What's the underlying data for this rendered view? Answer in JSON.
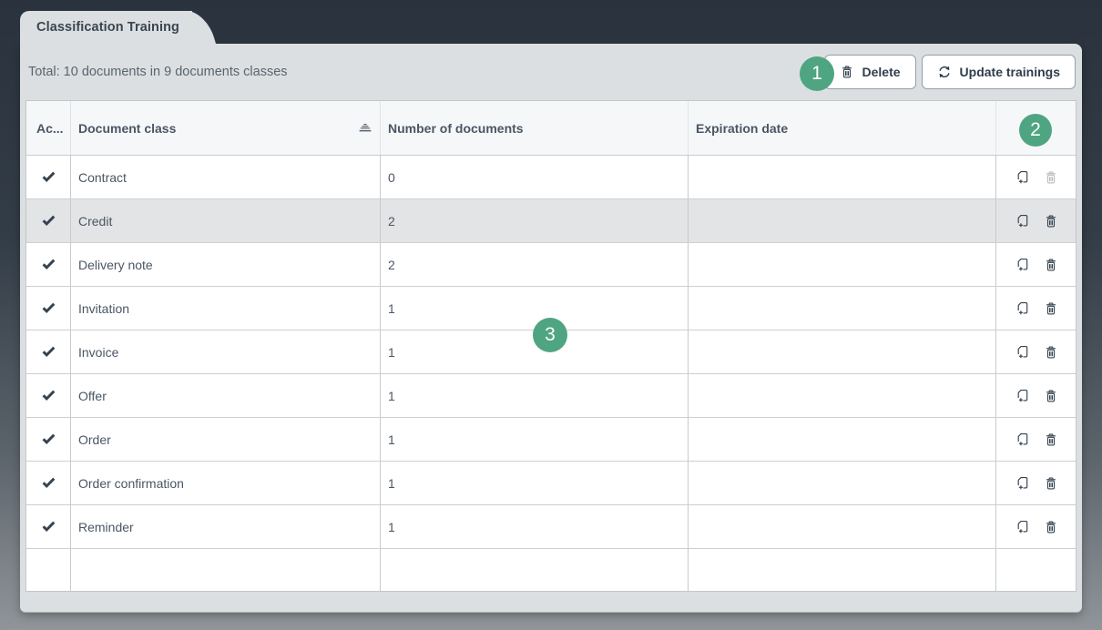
{
  "tab": {
    "label": "Classification Training"
  },
  "toolbar": {
    "summary": "Total: 10 documents in 9 documents classes",
    "buttons": [
      {
        "label": "Delete",
        "icon": "trash-icon"
      },
      {
        "label": "Update trainings",
        "icon": "refresh-icon"
      }
    ]
  },
  "table": {
    "columns": [
      {
        "key": "active",
        "label": "Ac..."
      },
      {
        "key": "document_class",
        "label": "Document class",
        "sorted": "asc"
      },
      {
        "key": "number_of_documents",
        "label": "Number of documents"
      },
      {
        "key": "expiration_date",
        "label": "Expiration date"
      },
      {
        "key": "actions",
        "label": ""
      }
    ],
    "rows": [
      {
        "active": true,
        "document_class": "Contract",
        "number_of_documents": "0",
        "expiration_date": "",
        "selected": false,
        "delete_enabled": false
      },
      {
        "active": true,
        "document_class": "Credit",
        "number_of_documents": "2",
        "expiration_date": "",
        "selected": true,
        "delete_enabled": true
      },
      {
        "active": true,
        "document_class": "Delivery note",
        "number_of_documents": "2",
        "expiration_date": "",
        "selected": false,
        "delete_enabled": true
      },
      {
        "active": true,
        "document_class": "Invitation",
        "number_of_documents": "1",
        "expiration_date": "",
        "selected": false,
        "delete_enabled": true
      },
      {
        "active": true,
        "document_class": "Invoice",
        "number_of_documents": "1",
        "expiration_date": "",
        "selected": false,
        "delete_enabled": true
      },
      {
        "active": true,
        "document_class": "Offer",
        "number_of_documents": "1",
        "expiration_date": "",
        "selected": false,
        "delete_enabled": true
      },
      {
        "active": true,
        "document_class": "Order",
        "number_of_documents": "1",
        "expiration_date": "",
        "selected": false,
        "delete_enabled": true
      },
      {
        "active": true,
        "document_class": "Order confirmation",
        "number_of_documents": "1",
        "expiration_date": "",
        "selected": false,
        "delete_enabled": true
      },
      {
        "active": true,
        "document_class": "Reminder",
        "number_of_documents": "1",
        "expiration_date": "",
        "selected": false,
        "delete_enabled": true
      }
    ]
  },
  "annotations": {
    "badges": [
      "1",
      "2",
      "3"
    ],
    "color": "#4FA582"
  },
  "colors": {
    "background_top": "#2A333D",
    "background_bottom": "#90959A",
    "panel": "#DCDFE1",
    "accent_green": "#4FA582",
    "row_selected": "#E3E4E6",
    "header_bg": "#F6F7F8",
    "text_dark": "#2F3D4C"
  }
}
